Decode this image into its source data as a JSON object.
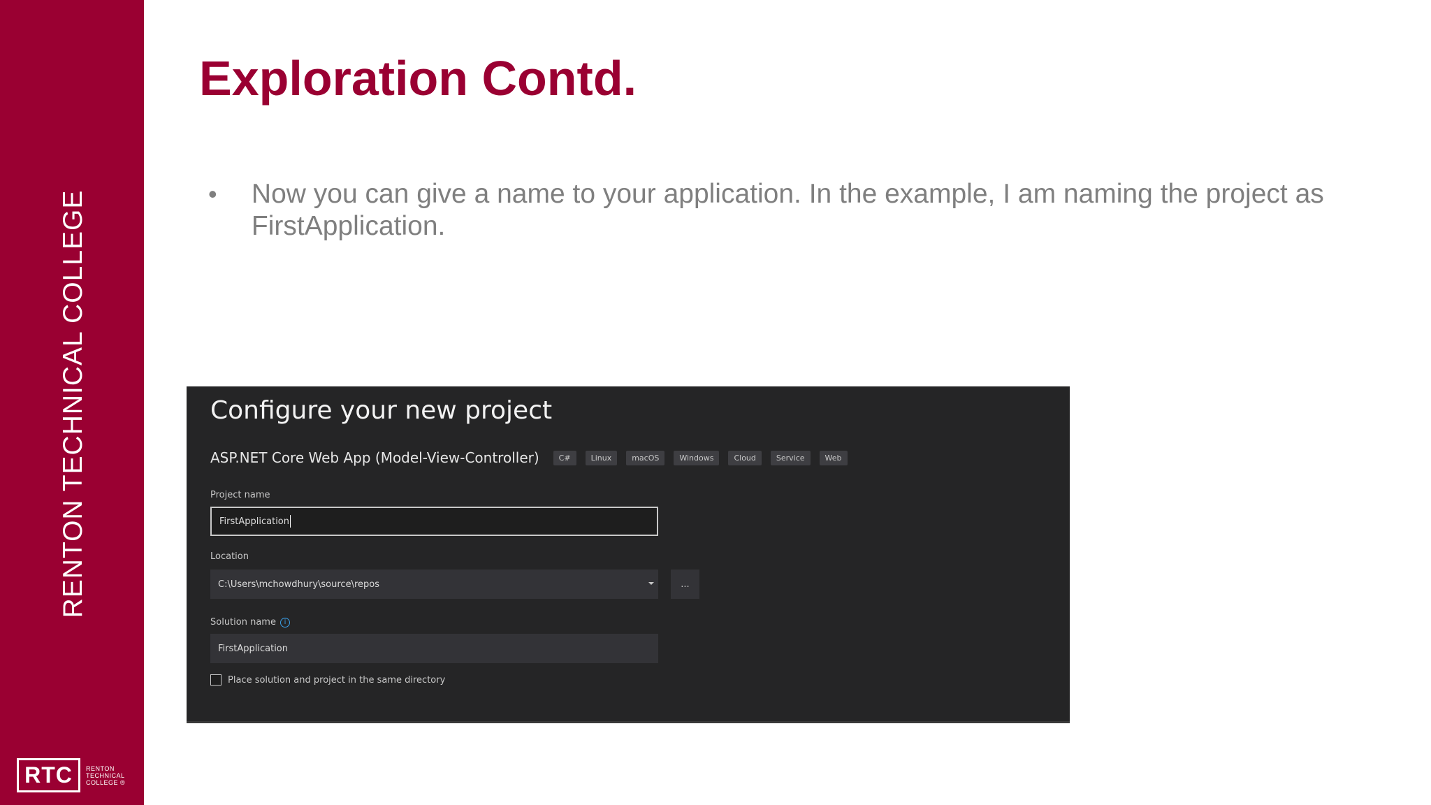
{
  "sidebar": {
    "vertical_text": "RENTON TECHNICAL COLLEGE",
    "logo_mark": "RTC",
    "logo_lines": [
      "RENTON",
      "TECHNICAL",
      "COLLEGE ®"
    ]
  },
  "slide": {
    "title": "Exploration Contd.",
    "bullets": [
      "Now you can give a name to your application. In the example, I am naming the project as FirstApplication."
    ]
  },
  "screenshot": {
    "title": "Configure your new project",
    "template_name": "ASP.NET Core Web App (Model-View-Controller)",
    "tags": [
      "C#",
      "Linux",
      "macOS",
      "Windows",
      "Cloud",
      "Service",
      "Web"
    ],
    "project_name_label": "Project name",
    "project_name_value": "FirstApplication",
    "location_label": "Location",
    "location_value": "C:\\Users\\mchowdhury\\source\\repos",
    "browse_label": "...",
    "solution_name_label": "Solution name",
    "solution_name_value": "FirstApplication",
    "checkbox_label": "Place solution and project in the same directory",
    "checkbox_checked": false
  },
  "colors": {
    "brand": "#9a0032",
    "body_text": "#7f7f7f",
    "panel_bg": "#252526",
    "info_accent": "#3aa0e8"
  }
}
